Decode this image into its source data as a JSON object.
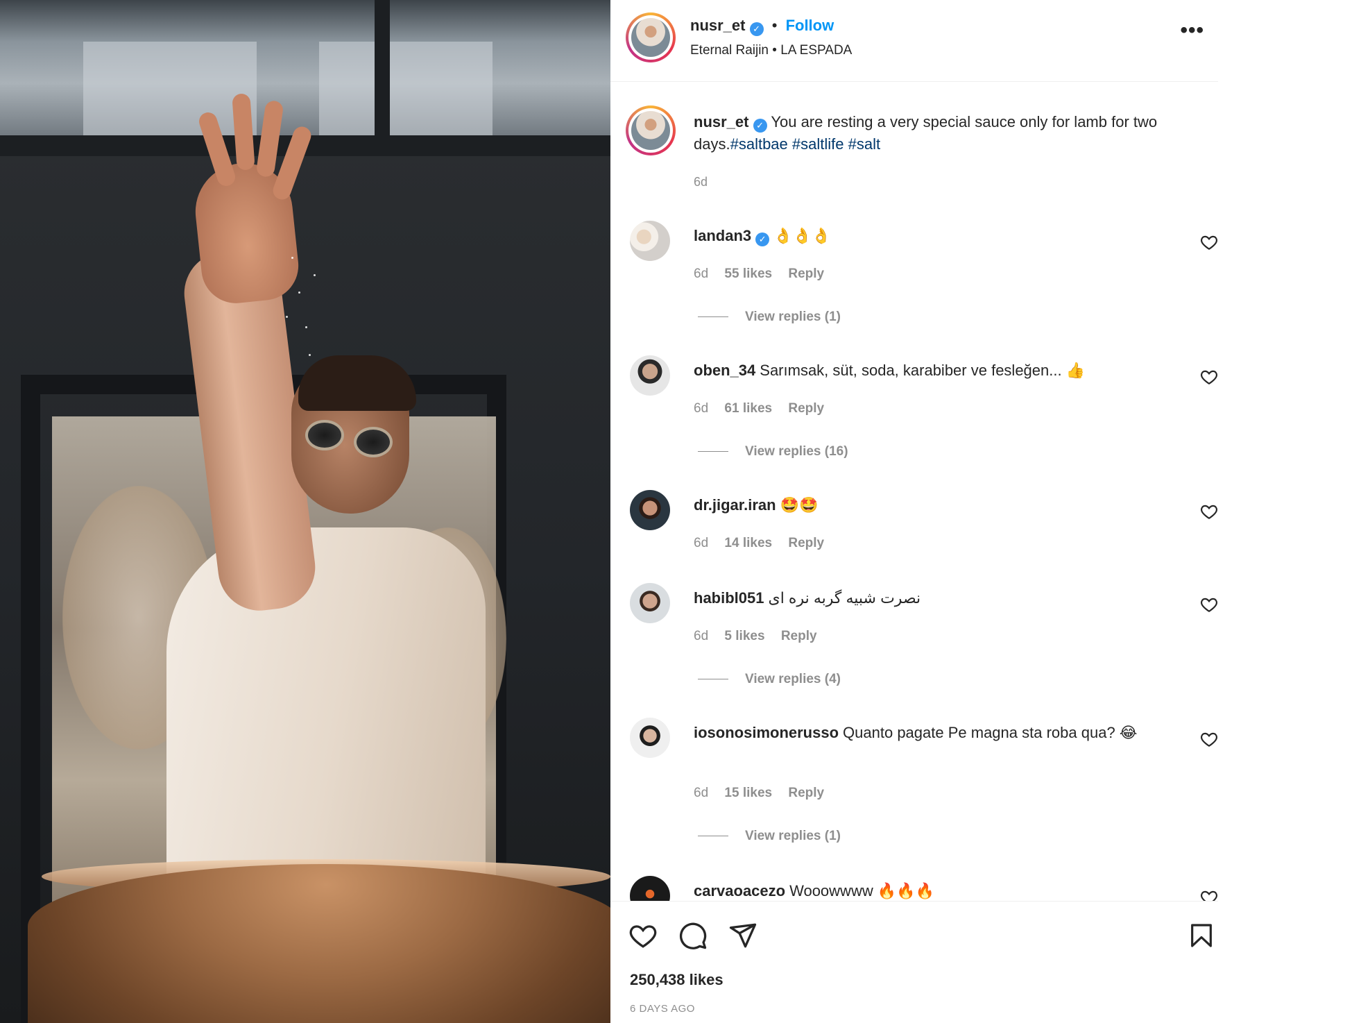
{
  "post": {
    "author": "nusr_et",
    "follow_label": "Follow",
    "dot": "•",
    "subtitle": "Eternal Raijin • LA ESPADA",
    "more_label": "•••",
    "verified_glyph": "✓"
  },
  "caption": {
    "username": "nusr_et",
    "text": "You are resting a very special sauce only for lamb for two days.",
    "hashtags": [
      "#saltbae",
      "#saltlife",
      "#salt"
    ],
    "time": "6d"
  },
  "comments": [
    {
      "username": "landan3",
      "verified": true,
      "text": "👌👌👌",
      "time": "6d",
      "likes": "55 likes",
      "reply": "Reply",
      "view_replies": "View replies (1)"
    },
    {
      "username": "oben_34",
      "verified": false,
      "text": "Sarımsak, süt, soda, karabiber ve fesleğen... 👍",
      "time": "6d",
      "likes": "61 likes",
      "reply": "Reply",
      "view_replies": "View replies (16)"
    },
    {
      "username": "dr.jigar.iran",
      "verified": false,
      "text": "🤩🤩",
      "time": "6d",
      "likes": "14 likes",
      "reply": "Reply",
      "view_replies": ""
    },
    {
      "username": "habibl051",
      "verified": false,
      "text": "نصرت شبیه گربه نره ای",
      "time": "6d",
      "likes": "5 likes",
      "reply": "Reply",
      "view_replies": "View replies (4)"
    },
    {
      "username": "iosonosimonerusso",
      "verified": false,
      "text": "Quanto pagate Pe magna sta roba qua? 😂",
      "time": "6d",
      "likes": "15 likes",
      "reply": "Reply",
      "view_replies": "View replies (1)"
    },
    {
      "username": "carvaoacezo",
      "verified": false,
      "text": "Wooowwww 🔥🔥🔥",
      "time": "",
      "likes": "",
      "reply": "",
      "view_replies": ""
    }
  ],
  "footer": {
    "likes": "250,438 likes",
    "date": "6 DAYS AGO"
  },
  "icons": {
    "like": "heart-icon",
    "comment": "comment-icon",
    "share": "share-icon",
    "save": "bookmark-icon",
    "more": "more-icon",
    "verified": "verified-badge-icon"
  },
  "colors": {
    "accent": "#0095f6",
    "verified": "#3897f0",
    "hashtag": "#00376b",
    "muted": "#8e8e8e",
    "text": "#262626"
  }
}
